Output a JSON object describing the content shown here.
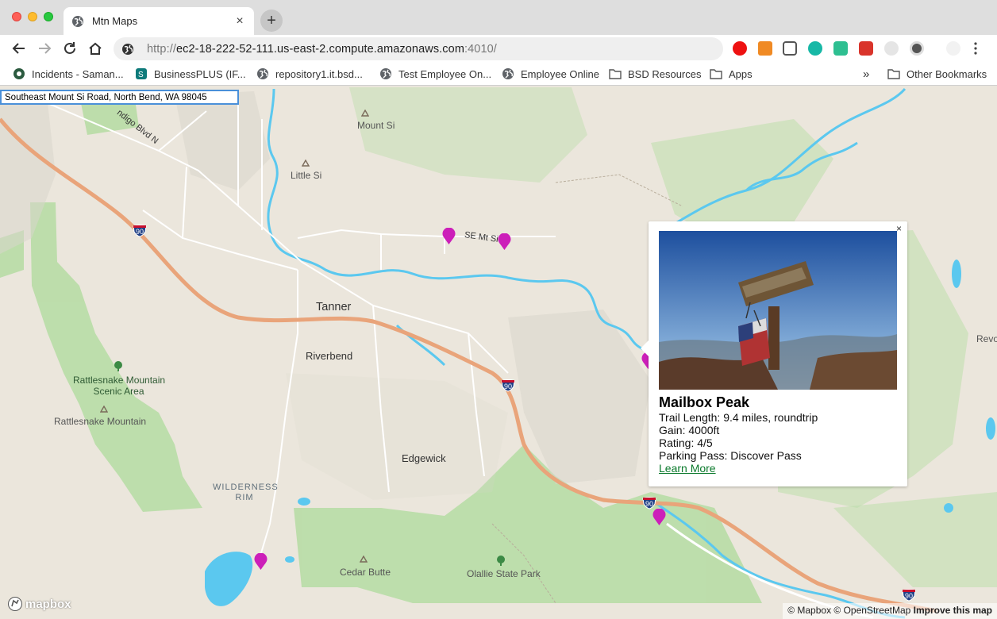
{
  "browser": {
    "tab_title": "Mtn Maps",
    "tab_close": "×",
    "new_tab": "+",
    "url_proto": "http://",
    "url_host": "ec2-18-222-52-111.us-east-2.compute.amazonaws.com",
    "url_port": ":4010/",
    "bookmarks": [
      {
        "label": "Incidents - Saman...",
        "icon": "incidents-icon"
      },
      {
        "label": "BusinessPLUS (IF...",
        "icon": "sharepoint-icon"
      },
      {
        "label": "repository1.it.bsd...",
        "icon": "globe-icon"
      },
      {
        "label": "Test Employee On...",
        "icon": "globe-icon"
      },
      {
        "label": "Employee Online",
        "icon": "globe-icon"
      },
      {
        "label": "BSD Resources",
        "icon": "folder-icon"
      },
      {
        "label": "Apps",
        "icon": "folder-icon"
      }
    ],
    "overflow": "»",
    "other_bookmarks": "Other Bookmarks"
  },
  "search": {
    "value": "Southeast Mount Si Road, North Bend, WA 98045"
  },
  "map": {
    "places": {
      "mount_si": "Mount Si",
      "little_si": "Little Si",
      "tanner": "Tanner",
      "riverbend": "Riverbend",
      "edgewick": "Edgewick",
      "rattlesnake_area_1": "Rattlesnake Mountain",
      "rattlesnake_area_2": "Scenic Area",
      "rattlesnake_mtn": "Rattlesnake Mountain",
      "wilderness_1": "WILDERNESS",
      "wilderness_2": "RIM",
      "cedar_butte": "Cedar Butte",
      "olallie": "Olallie State Park",
      "revo": "Revo"
    },
    "roads": {
      "se_mt_si": "SE Mt Si",
      "indigo": "ndigo Blvd N",
      "i90": "90"
    },
    "pin_color": "#cc1fb9",
    "water_color": "#5bc8ef",
    "park_color": "#b5dca3",
    "highway_color": "#e9a47a"
  },
  "popup": {
    "close": "×",
    "title": "Mailbox Peak",
    "trail_length": "Trail Length: 9.4 miles, roundtrip",
    "gain": "Gain: 4000ft",
    "rating": "Rating: 4/5",
    "parking": "Parking Pass: Discover Pass",
    "link": "Learn More"
  },
  "footer": {
    "logo": "mapbox",
    "attribution_1": "© Mapbox © OpenStreetMap",
    "attribution_2": "Improve this map"
  }
}
